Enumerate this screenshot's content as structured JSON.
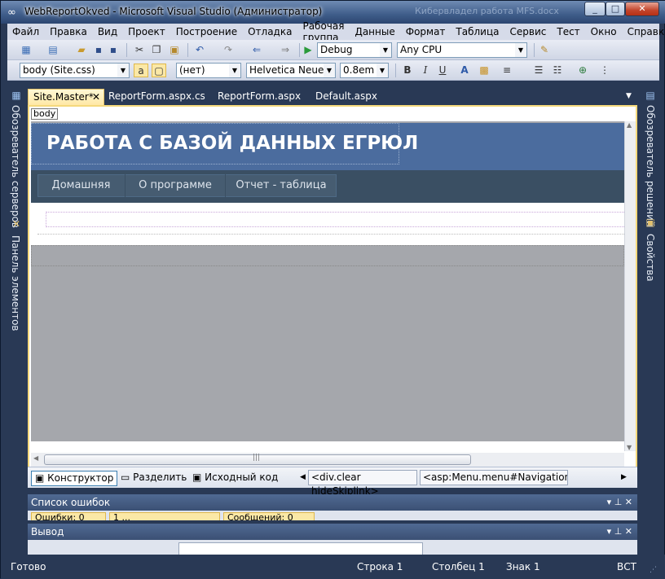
{
  "window": {
    "title": "WebReportOkved - Microsoft Visual Studio (Администратор)",
    "ghost_title": "Кибервладел работа MFS.docx"
  },
  "menu": [
    "Файл",
    "Правка",
    "Вид",
    "Проект",
    "Построение",
    "Отладка",
    "Рабочая группа",
    "Данные",
    "Формат",
    "Таблица",
    "Сервис",
    "Тест",
    "Окно",
    "Справка"
  ],
  "toolbar1": {
    "config": "Debug",
    "platform": "Any CPU"
  },
  "toolbar2": {
    "style": "body (Site.css)",
    "block": "(нет)",
    "font": "Helvetica Neue, L",
    "size": "0.8em"
  },
  "left_panels": [
    "Обозреватель серверов",
    "Панель элементов"
  ],
  "right_panels": [
    "Обозреватель решений",
    "Свойства"
  ],
  "tabs": [
    "Site.Master*",
    "ReportForm.aspx.cs",
    "ReportForm.aspx",
    "Default.aspx"
  ],
  "tag_label": "body",
  "site": {
    "heading": "РАБОТА С БАЗОЙ ДАННЫХ ЕГРЮЛ",
    "nav": [
      "Домашняя",
      "О программе",
      "Отчет - таблица"
    ]
  },
  "view_buttons": {
    "design": "Конструктор",
    "split": "Разделить",
    "source": "Исходный код"
  },
  "breadcrumbs": [
    "<div.clear hideSkiplink>",
    "<asp:Menu.menu#Navigation...>"
  ],
  "panels": {
    "errors": "Список ошибок",
    "output": "Вывод",
    "errors_tabs": [
      "Ошибки: 0",
      "1 ...",
      "Сообщений: 0"
    ]
  },
  "status": {
    "ready": "Готово",
    "row": "Строка 1",
    "col": "Столбец 1",
    "char": "Знак 1",
    "mode": "ВСТ"
  },
  "colors": {
    "header_bg": "#4b6c9e",
    "nav_bg": "#3a4f63",
    "nav_item": "#465c71",
    "canvas": "#a5a7ac"
  }
}
